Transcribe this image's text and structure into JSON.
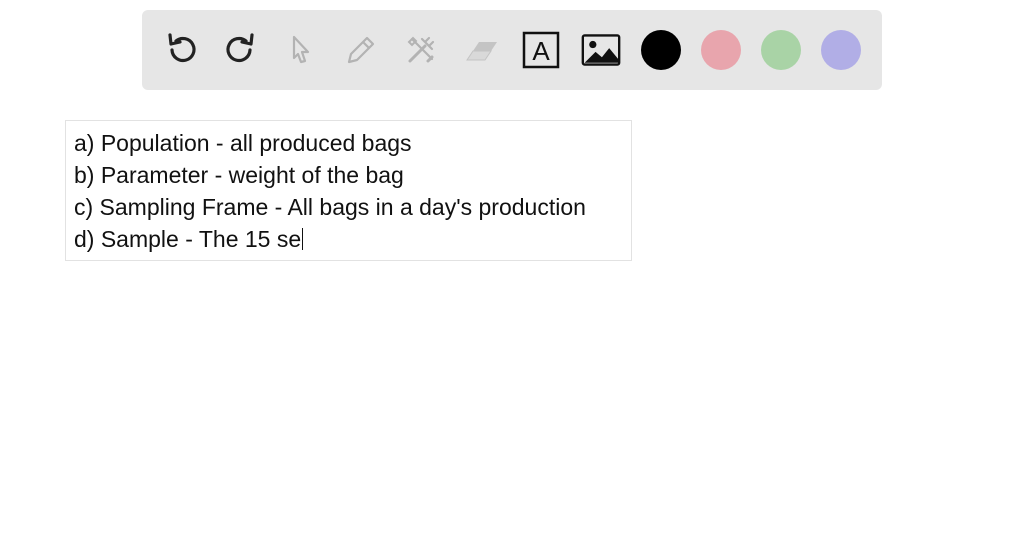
{
  "toolbar": {
    "tools": [
      {
        "icon": "undo-icon",
        "enabled": true
      },
      {
        "icon": "redo-icon",
        "enabled": true
      },
      {
        "icon": "pointer-icon",
        "enabled": false
      },
      {
        "icon": "pencil-icon",
        "enabled": false
      },
      {
        "icon": "tools-icon",
        "enabled": false
      },
      {
        "icon": "eraser-icon",
        "enabled": false
      },
      {
        "icon": "text-tool-icon",
        "enabled": true
      },
      {
        "icon": "image-icon",
        "enabled": true
      }
    ],
    "text_tool_glyph": "A",
    "colors": [
      {
        "name": "black",
        "hex": "#000000"
      },
      {
        "name": "pink",
        "hex": "#e8a5ad"
      },
      {
        "name": "green",
        "hex": "#a9d3a6"
      },
      {
        "name": "lavender",
        "hex": "#b1aee6"
      }
    ]
  },
  "note": {
    "lines": [
      "a) Population - all produced bags",
      "b) Parameter - weight of the bag",
      "c) Sampling Frame - All bags in a day's production",
      "d) Sample - The 15 se"
    ]
  }
}
